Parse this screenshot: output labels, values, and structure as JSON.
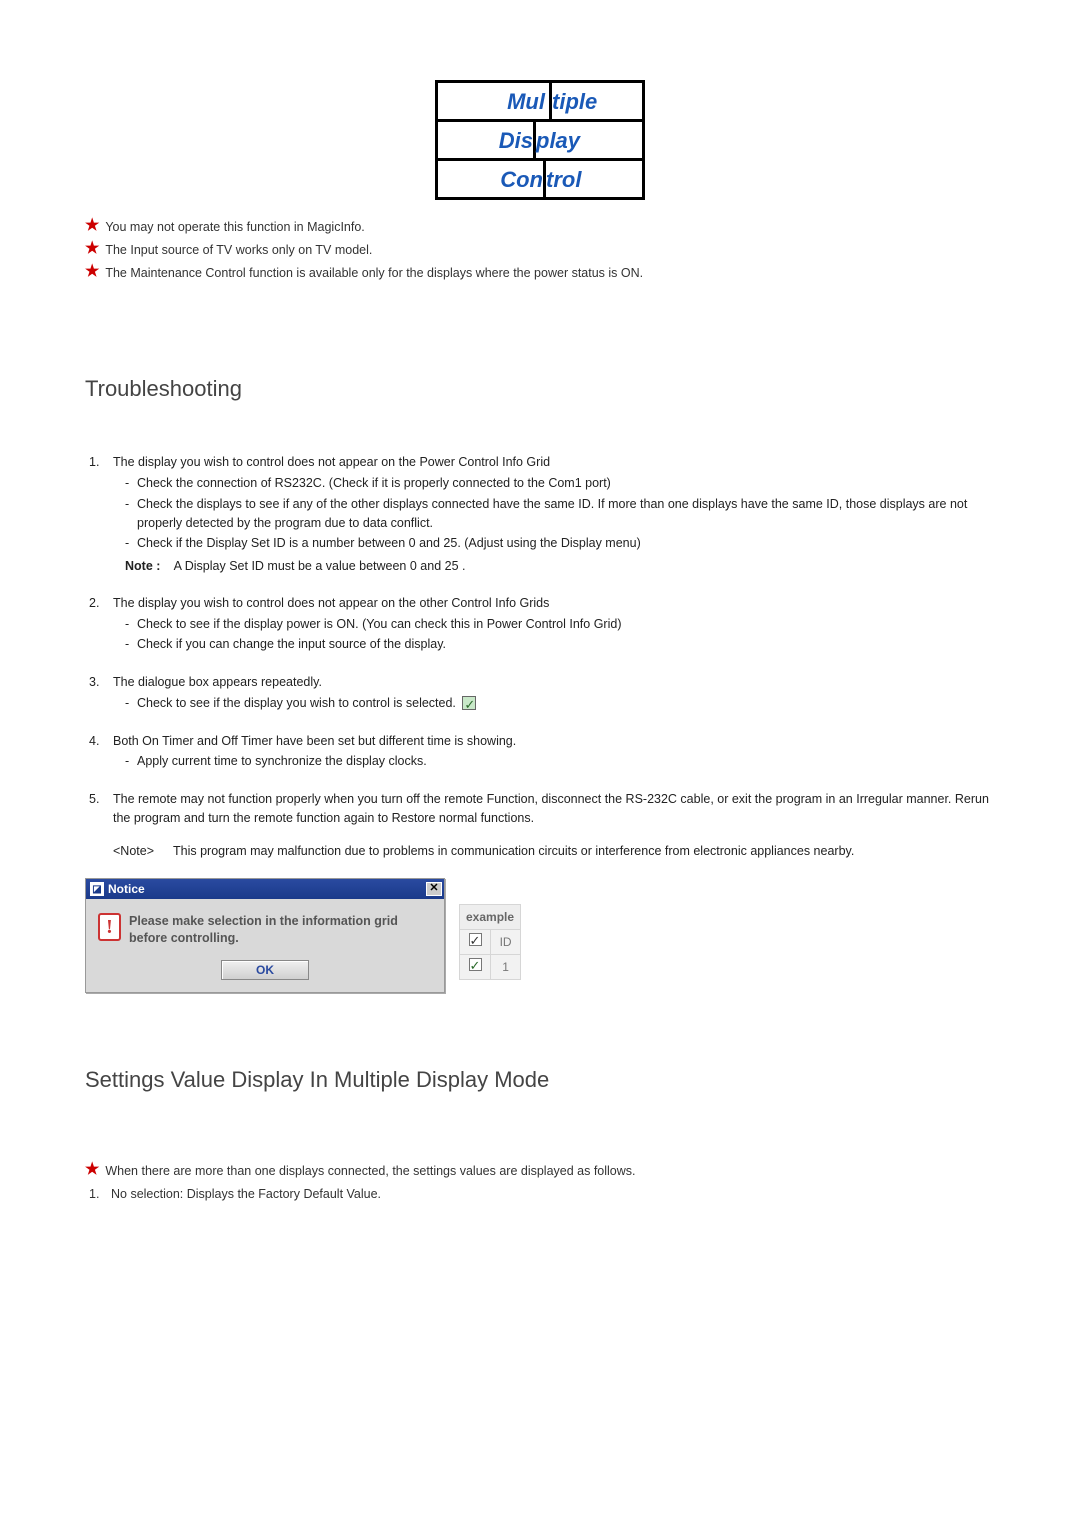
{
  "logo": {
    "line1a": "Mul",
    "line1b": "tiple",
    "line2a": "Dis",
    "line2b": "play",
    "line3a": "Con",
    "line3b": "trol"
  },
  "intro_notes": [
    "You may not operate this function in MagicInfo.",
    "The Input source of TV works only on TV model.",
    "The Maintenance Control function is available only for the displays where the power status is ON."
  ],
  "troubleshooting": {
    "heading": "Troubleshooting",
    "items": [
      {
        "title": "The display you wish to control does not appear on the Power Control Info Grid",
        "subs": [
          "Check the connection of RS232C. (Check if it is properly connected to the Com1 port)",
          "Check the displays to see if any of the other displays connected have the same ID. If more than one displays have the same ID, those displays are not properly detected by the program due to data conflict.",
          "Check if the Display Set ID is a number between 0 and 25. (Adjust using the Display menu)"
        ],
        "note_label": "Note :",
        "note_text": "A Display Set ID must be a value between 0 and 25 ."
      },
      {
        "title": "The display you wish to control does not appear on the other Control Info Grids",
        "subs": [
          "Check to see if the display power is ON. (You can check this in Power Control Info Grid)",
          "Check if you can change the input source of the display."
        ]
      },
      {
        "title": "The dialogue box appears repeatedly.",
        "subs_with_check": "Check to see if the display you wish to control is selected."
      },
      {
        "title": "Both On Timer and Off Timer have been set but different time is showing.",
        "subs": [
          "Apply current time to synchronize the display clocks."
        ]
      },
      {
        "title": "The remote may not function properly when you turn off the remote Function, disconnect the RS-232C cable, or exit the program in an Irregular manner. Rerun the program and turn the remote function again to Restore normal functions.",
        "extra_label": "<Note>",
        "extra_text": "This program may malfunction due to problems in communication circuits or interference from electronic appliances nearby."
      }
    ]
  },
  "dialog": {
    "title": "Notice",
    "message": "Please make selection in the information grid before controlling.",
    "ok_label": "OK"
  },
  "example": {
    "header": "example",
    "col1": "",
    "col2": "ID",
    "row1_id": "1"
  },
  "settings": {
    "heading": "Settings Value Display In Multiple Display Mode",
    "star_note": "When there are more than one displays connected, the settings values are displayed as follows.",
    "item1_num": "1.",
    "item1_text": "No selection: Displays the Factory Default Value."
  }
}
